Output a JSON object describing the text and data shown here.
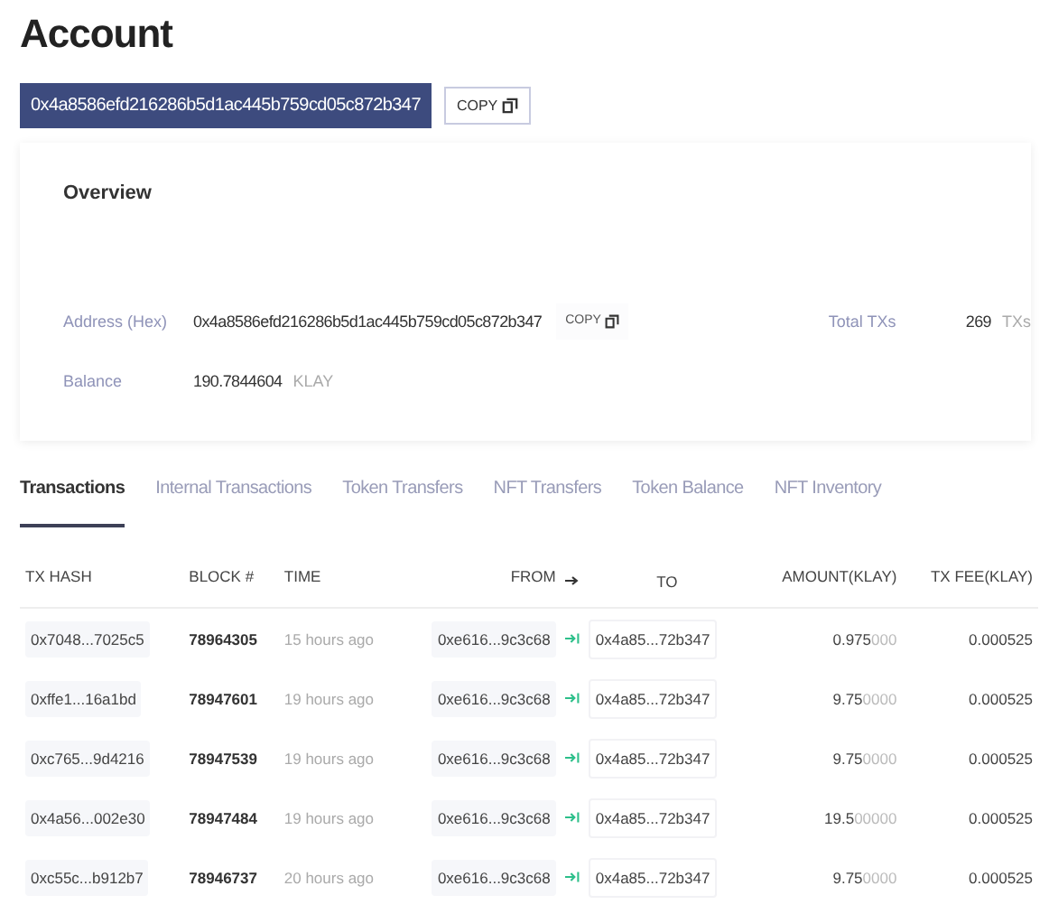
{
  "page_title": "Account",
  "address_bar": {
    "address": "0x4a8586efd216286b5d1ac445b759cd05c872b347",
    "copy_label": "COPY"
  },
  "overview": {
    "title": "Overview",
    "address_label": "Address (Hex)",
    "address": "0x4a8586efd216286b5d1ac445b759cd05c872b347",
    "copy_label": "COPY",
    "total_label": "Total TXs",
    "total_value": "269",
    "total_unit": "TXs",
    "balance_label": "Balance",
    "balance_value": "190.7844604",
    "balance_unit": "KLAY"
  },
  "tabs": [
    {
      "label": "Transactions",
      "selected": true
    },
    {
      "label": "Internal Transactions",
      "selected": false
    },
    {
      "label": "Token Transfers",
      "selected": false
    },
    {
      "label": "NFT Transfers",
      "selected": false
    },
    {
      "label": "Token Balance",
      "selected": false
    },
    {
      "label": "NFT Inventory",
      "selected": false
    }
  ],
  "table": {
    "columns": [
      "TX HASH",
      "BLOCK #",
      "TIME",
      "FROM",
      "TO",
      "AMOUNT(KLAY)",
      "TX FEE(KLAY)"
    ],
    "rows": [
      {
        "hash": "0x7048...7025c5",
        "block": "78964305",
        "time": "15 hours ago",
        "from": "0xe616...9c3c68",
        "to": "0x4a85...72b347",
        "amount": "0.975",
        "amount_zeros": "000",
        "fee": "0.000525"
      },
      {
        "hash": "0xffe1...16a1bd",
        "block": "78947601",
        "time": "19 hours ago",
        "from": "0xe616...9c3c68",
        "to": "0x4a85...72b347",
        "amount": "9.75",
        "amount_zeros": "0000",
        "fee": "0.000525"
      },
      {
        "hash": "0xc765...9d4216",
        "block": "78947539",
        "time": "19 hours ago",
        "from": "0xe616...9c3c68",
        "to": "0x4a85...72b347",
        "amount": "9.75",
        "amount_zeros": "0000",
        "fee": "0.000525"
      },
      {
        "hash": "0x4a56...002e30",
        "block": "78947484",
        "time": "19 hours ago",
        "from": "0xe616...9c3c68",
        "to": "0x4a85...72b347",
        "amount": "19.5",
        "amount_zeros": "00000",
        "fee": "0.000525"
      },
      {
        "hash": "0xc55c...b912b7",
        "block": "78946737",
        "time": "20 hours ago",
        "from": "0xe616...9c3c68",
        "to": "0x4a85...72b347",
        "amount": "9.75",
        "amount_zeros": "0000",
        "fee": "0.000525"
      }
    ]
  }
}
